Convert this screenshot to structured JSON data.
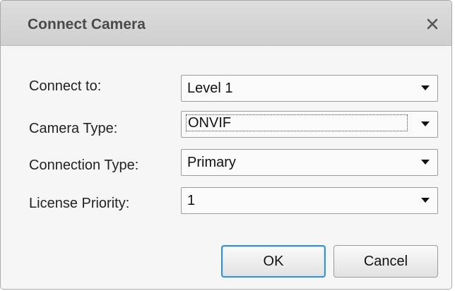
{
  "dialog": {
    "title": "Connect Camera",
    "close_icon": "close-icon"
  },
  "fields": [
    {
      "label": "Connect to:",
      "value": "Level 1"
    },
    {
      "label": "Camera Type:",
      "value": "ONVIF"
    },
    {
      "label": "Connection Type:",
      "value": "Primary"
    },
    {
      "label": "License Priority:",
      "value": "1"
    }
  ],
  "buttons": {
    "ok_label": "OK",
    "cancel_label": "Cancel"
  },
  "colors": {
    "title_bar": "#d6d6d6",
    "default_button_border": "#3c8fd1",
    "body_background": "#f6f6f6"
  }
}
